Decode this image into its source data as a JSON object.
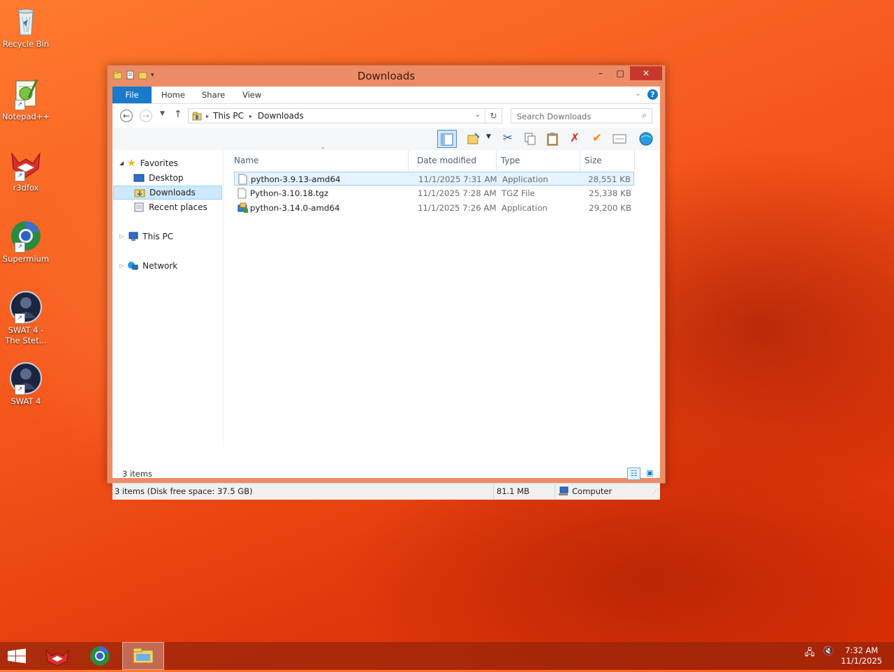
{
  "desktop": {
    "icons": [
      {
        "label": "Recycle Bin",
        "icon": "recycle-bin-icon"
      },
      {
        "label": "Notepad++",
        "icon": "notepad-plus-plus-icon"
      },
      {
        "label": "r3dfox",
        "icon": "r3dfox-icon"
      },
      {
        "label": "Supermium",
        "icon": "supermium-icon"
      },
      {
        "label_line1": "SWAT 4 -",
        "label_line2": "The Stet...",
        "icon": "swat4-stetchkov-icon"
      },
      {
        "label": "SWAT 4",
        "icon": "swat4-icon"
      }
    ]
  },
  "window": {
    "title": "Downloads",
    "controls": {
      "minimize": "–",
      "maximize": "□",
      "close": "✕"
    },
    "ribbon_tabs": [
      "File",
      "Home",
      "Share",
      "View"
    ],
    "help": "?",
    "address": {
      "crumbs": [
        "This PC",
        "Downloads"
      ]
    },
    "search": {
      "placeholder": "Search Downloads"
    },
    "navigation": {
      "favorites": "Favorites",
      "desktop": "Desktop",
      "downloads": "Downloads",
      "recent": "Recent places",
      "this_pc": "This PC",
      "network": "Network"
    },
    "columns": {
      "name": "Name",
      "date": "Date modified",
      "type": "Type",
      "size": "Size"
    },
    "files": [
      {
        "name": "python-3.9.13-amd64",
        "date": "11/1/2025 7:31 AM",
        "type": "Application",
        "size": "28,551 KB",
        "selected": true
      },
      {
        "name": "Python-3.10.18.tgz",
        "date": "11/1/2025 7:28 AM",
        "type": "TGZ File",
        "size": "25,338 KB",
        "selected": false
      },
      {
        "name": "python-3.14.0-amd64",
        "date": "11/1/2025 7:26 AM",
        "type": "Application",
        "size": "29,200 KB",
        "selected": false
      }
    ],
    "item_count": "3 items",
    "status": {
      "summary": "3 items (Disk free space: 37.5 GB)",
      "size": "81.1 MB",
      "location": "Computer"
    }
  },
  "taskbar": {
    "clock_time": "7:32 AM",
    "clock_date": "11/1/2025"
  },
  "colors": {
    "accent": "#1979ca",
    "window_frame": "#ec8c66",
    "close_button": "#c7382c",
    "selection": "#cde8ff"
  }
}
